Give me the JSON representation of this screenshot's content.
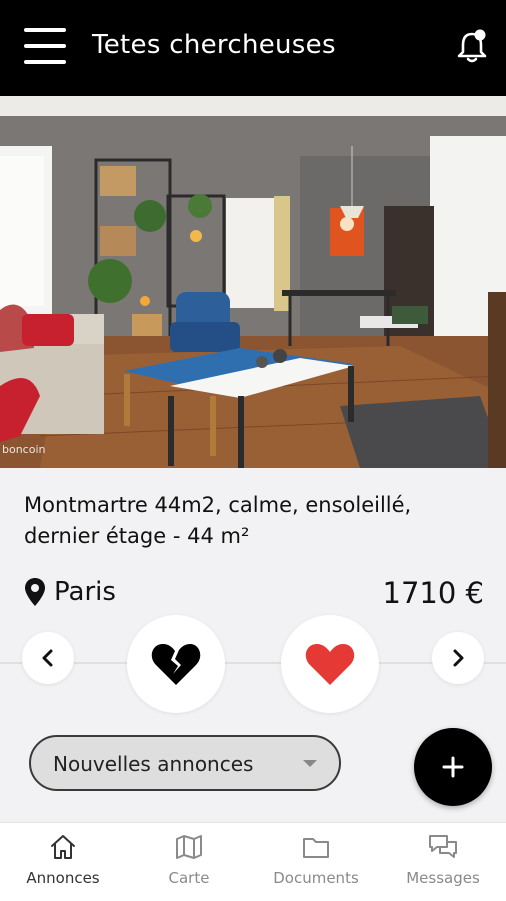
{
  "header": {
    "title": "Tetes chercheuses"
  },
  "photo": {
    "credit": "boncoin"
  },
  "listing": {
    "title": "Montmartre 44m2, calme, ensoleillé, dernier étage - 44 m²",
    "location": "Paris",
    "price": "1710 €"
  },
  "filter": {
    "selected": "Nouvelles annonces"
  },
  "nav": {
    "items": [
      {
        "label": "Annonces",
        "icon": "home-icon",
        "active": true
      },
      {
        "label": "Carte",
        "icon": "map-icon",
        "active": false
      },
      {
        "label": "Documents",
        "icon": "folder-icon",
        "active": false
      },
      {
        "label": "Messages",
        "icon": "chat-icon",
        "active": false
      }
    ]
  },
  "colors": {
    "header_bg": "#000000",
    "like_red": "#e53935",
    "dislike": "#000000"
  }
}
